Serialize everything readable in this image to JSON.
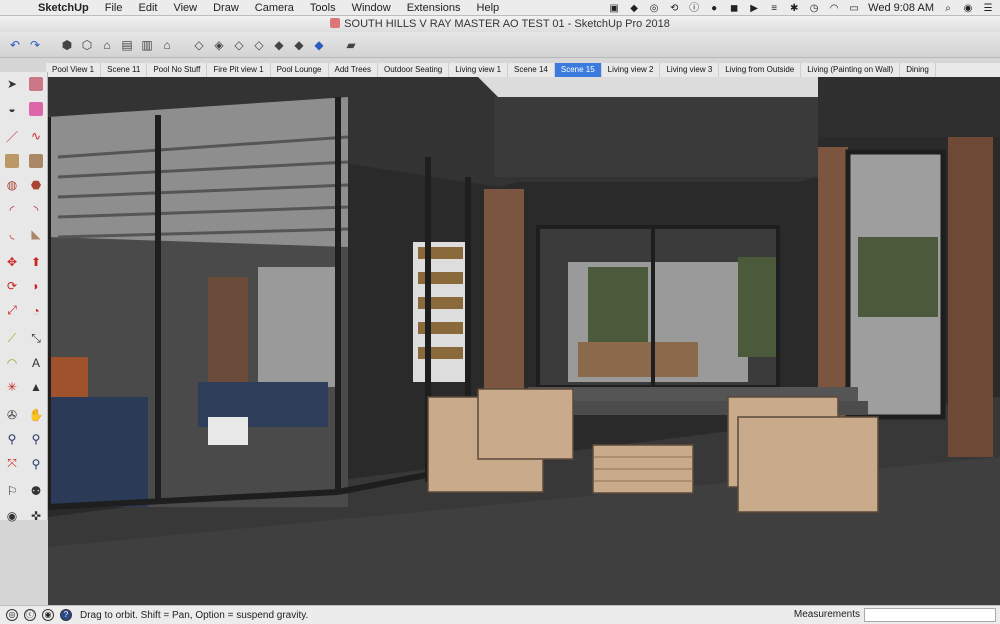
{
  "menubar": {
    "app_name": "SketchUp",
    "items": [
      "File",
      "Edit",
      "View",
      "Draw",
      "Camera",
      "Tools",
      "Window",
      "Extensions",
      "Help"
    ],
    "clock": "Wed 9:08 AM"
  },
  "window": {
    "title": "SOUTH HILLS V RAY MASTER AO TEST 01 - SketchUp Pro 2018"
  },
  "scenes": {
    "tabs": [
      "Pool View 1",
      "Scene 11",
      "Pool No Stuff",
      "Fire Pit view 1",
      "Pool Lounge",
      "Add Trees",
      "Outdoor Seating",
      "Living view 1",
      "Scene 14",
      "Scene 15",
      "Living view 2",
      "Living view 3",
      "Living from Outside",
      "Living (Painting on Wall)",
      "Dining"
    ],
    "active": "Scene 15"
  },
  "status": {
    "hint": "Drag to orbit. Shift = Pan, Option = suspend gravity.",
    "measurements_label": "Measurements",
    "measurements_value": ""
  },
  "colors": {
    "active_tab": "#3b7bde",
    "sky": "#dcdcdc",
    "wood": "#7b5540",
    "furniture": "#c9ab8b",
    "glass_frame": "#1e1e1e"
  }
}
